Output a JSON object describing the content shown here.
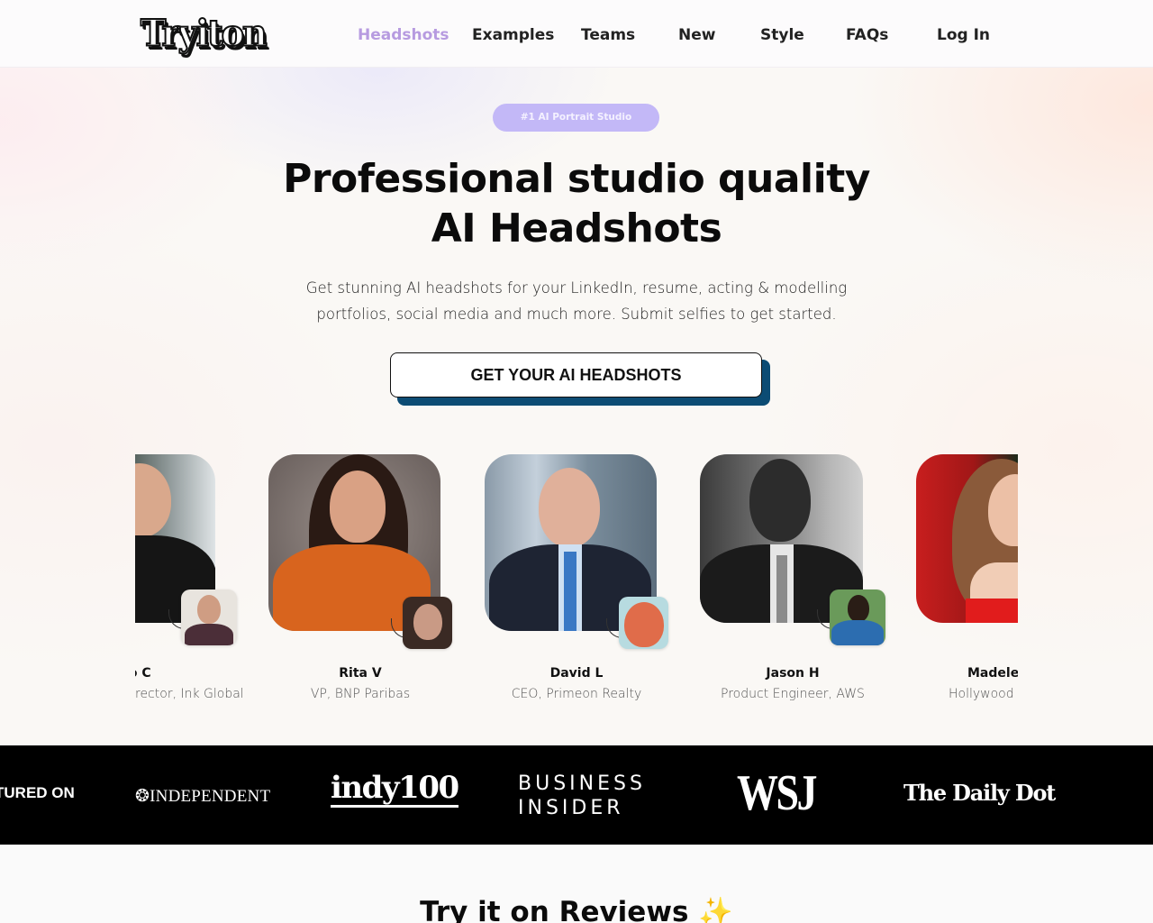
{
  "nav": {
    "logo": "Tryiton",
    "links": [
      {
        "label": "Headshots",
        "active": true
      },
      {
        "label": "Examples",
        "active": false
      },
      {
        "label": "Teams",
        "active": false
      },
      {
        "label": "New",
        "active": false
      },
      {
        "label": "Style",
        "active": false
      },
      {
        "label": "FAQs",
        "active": false
      },
      {
        "label": "Log In",
        "active": false
      }
    ]
  },
  "hero": {
    "badge": "#1 AI Portrait Studio",
    "headline_line1": "Professional studio quality",
    "headline_line2": "AI Headshots",
    "subtitle_line1": "Get stunning AI headshots for your LinkedIn, resume, acting & modelling",
    "subtitle_line2": "portfolios, social media and much more. Submit selfies to get started.",
    "cta_label": "GET YOUR AI HEADSHOTS"
  },
  "carousel": {
    "items": [
      {
        "name": "tteo C",
        "role": "rector, Ink Global",
        "icon": "portrait-image"
      },
      {
        "name": "Rita V",
        "role": "VP, BNP Paribas",
        "icon": "portrait-image"
      },
      {
        "name": "David L",
        "role": "CEO, Primeon Realty",
        "icon": "portrait-image"
      },
      {
        "name": "Jason H",
        "role": "Product Engineer, AWS",
        "icon": "portrait-image"
      },
      {
        "name": "Madele",
        "role": "Hollywood",
        "icon": "portrait-image"
      }
    ]
  },
  "press": {
    "label": "TURED ON",
    "logos": {
      "independent": "❂INDEPENDENT",
      "indy100": "indy100",
      "business_insider_line1": "BUSINESS",
      "business_insider_line2": "INSIDER",
      "wsj": "WSJ",
      "daily_dot": "The Daily Dot"
    }
  },
  "reviews": {
    "title": "Try it on Reviews",
    "emoji": "✨"
  },
  "colors": {
    "accent_purple": "#b79be0",
    "badge_bg": "#c3b8f7",
    "cta_shadow": "#0c4c74",
    "press_bg": "#000000"
  }
}
